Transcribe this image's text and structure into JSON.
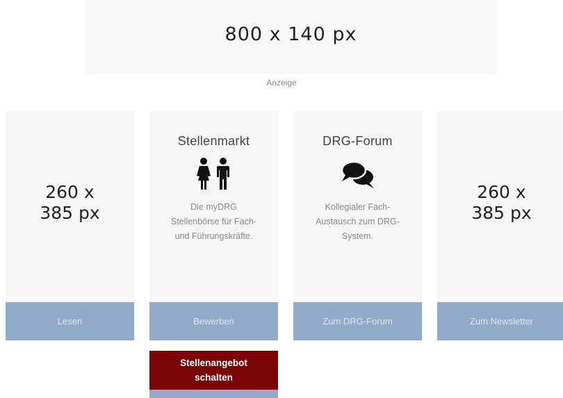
{
  "banner": {
    "text": "800 x 140 px",
    "ad_label": "Anzeige"
  },
  "cards": [
    {
      "placeholder": "260 x\n385 px",
      "button_label": "Lesen"
    },
    {
      "title": "Stellenmarkt",
      "icon": "people-icon",
      "description": "Die myDRG Stellenbörse für Fach- und Führungskräfte.",
      "button_label": "Bewerben"
    },
    {
      "title": "DRG-Forum",
      "icon": "chat-bubbles-icon",
      "description": "Kollegialer Fach-Austausch zum DRG-System.",
      "button_label": "Zum DRG-Forum"
    },
    {
      "placeholder": "260 x\n385 px",
      "button_label": "Zum Newsletter"
    }
  ],
  "cta": {
    "line1": "Stellenangebot",
    "line2": "schalten"
  },
  "colors": {
    "button_bg": "#92abc8",
    "cta_bg": "#7a0404",
    "card_bg": "#f6f6f6"
  }
}
